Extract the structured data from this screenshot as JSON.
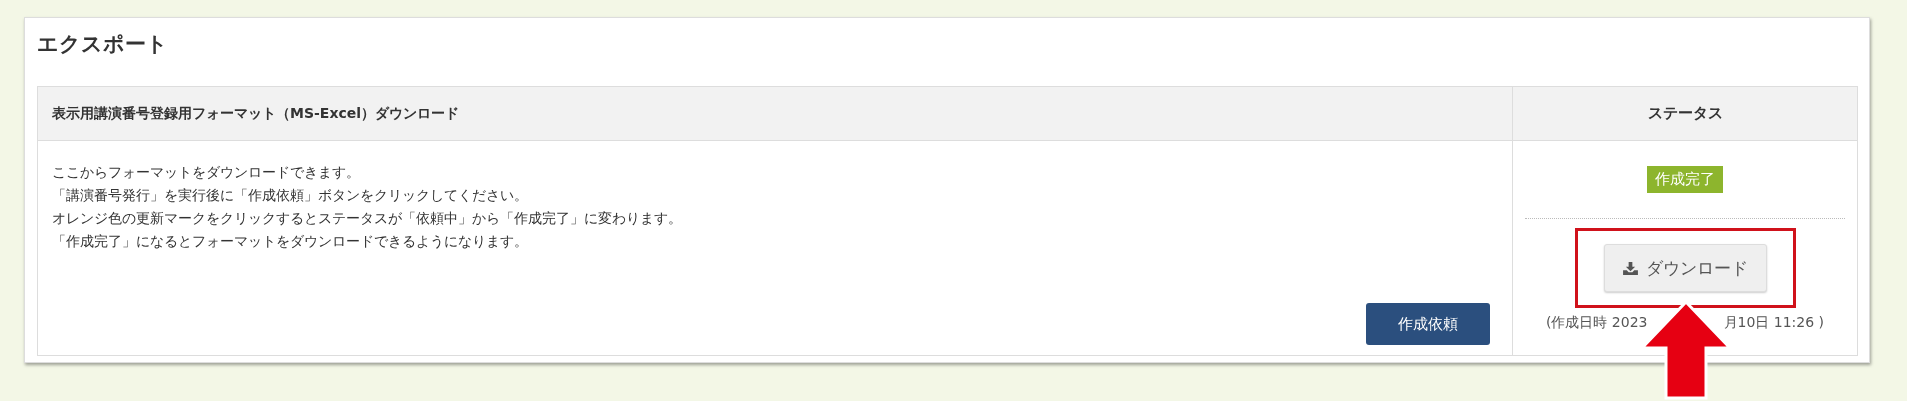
{
  "panel": {
    "title": "エクスポート"
  },
  "table": {
    "columns": [
      "表示用講演番号登録用フォーマット（MS-Excel）ダウンロード",
      "ステータス"
    ],
    "description": [
      "ここからフォーマットをダウンロードできます。",
      "「講演番号発行」を実行後に「作成依頼」ボタンをクリックしてください。",
      "オレンジ色の更新マークをクリックするとステータスが「依頼中」から「作成完了」に変わります。",
      "「作成完了」になるとフォーマットをダウンロードできるようになります。"
    ],
    "request_button": "作成依頼",
    "status": {
      "label": "作成完了",
      "color": "#8db52d"
    },
    "download_button": "ダウンロード",
    "created": [
      "(作成日時 2023",
      "月10日 11:26 )"
    ]
  }
}
